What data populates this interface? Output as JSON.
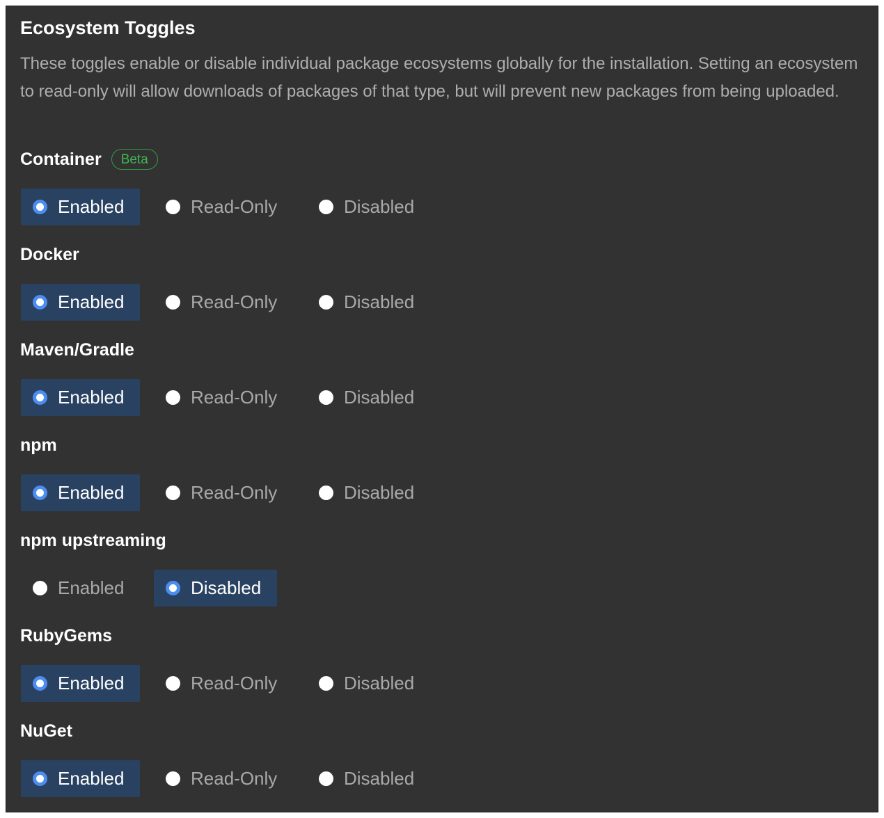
{
  "panel": {
    "title": "Ecosystem Toggles",
    "description": "These toggles enable or disable individual package ecosystems globally for the installation. Setting an ecosystem to read-only will allow downloads of packages of that type, but will prevent new packages from being uploaded."
  },
  "colors": {
    "panel_background": "#323232",
    "selected_background": "#2a4262",
    "selected_radio": "#4d8df0",
    "beta_badge": "#3fb950"
  },
  "ecosystems": [
    {
      "name": "Container",
      "badge": "Beta",
      "selected": "Enabled",
      "options": [
        "Enabled",
        "Read-Only",
        "Disabled"
      ]
    },
    {
      "name": "Docker",
      "selected": "Enabled",
      "options": [
        "Enabled",
        "Read-Only",
        "Disabled"
      ]
    },
    {
      "name": "Maven/Gradle",
      "selected": "Enabled",
      "options": [
        "Enabled",
        "Read-Only",
        "Disabled"
      ]
    },
    {
      "name": "npm",
      "selected": "Enabled",
      "options": [
        "Enabled",
        "Read-Only",
        "Disabled"
      ]
    },
    {
      "name": "npm upstreaming",
      "selected": "Disabled",
      "options": [
        "Enabled",
        "Disabled"
      ]
    },
    {
      "name": "RubyGems",
      "selected": "Enabled",
      "options": [
        "Enabled",
        "Read-Only",
        "Disabled"
      ]
    },
    {
      "name": "NuGet",
      "selected": "Enabled",
      "options": [
        "Enabled",
        "Read-Only",
        "Disabled"
      ]
    }
  ]
}
